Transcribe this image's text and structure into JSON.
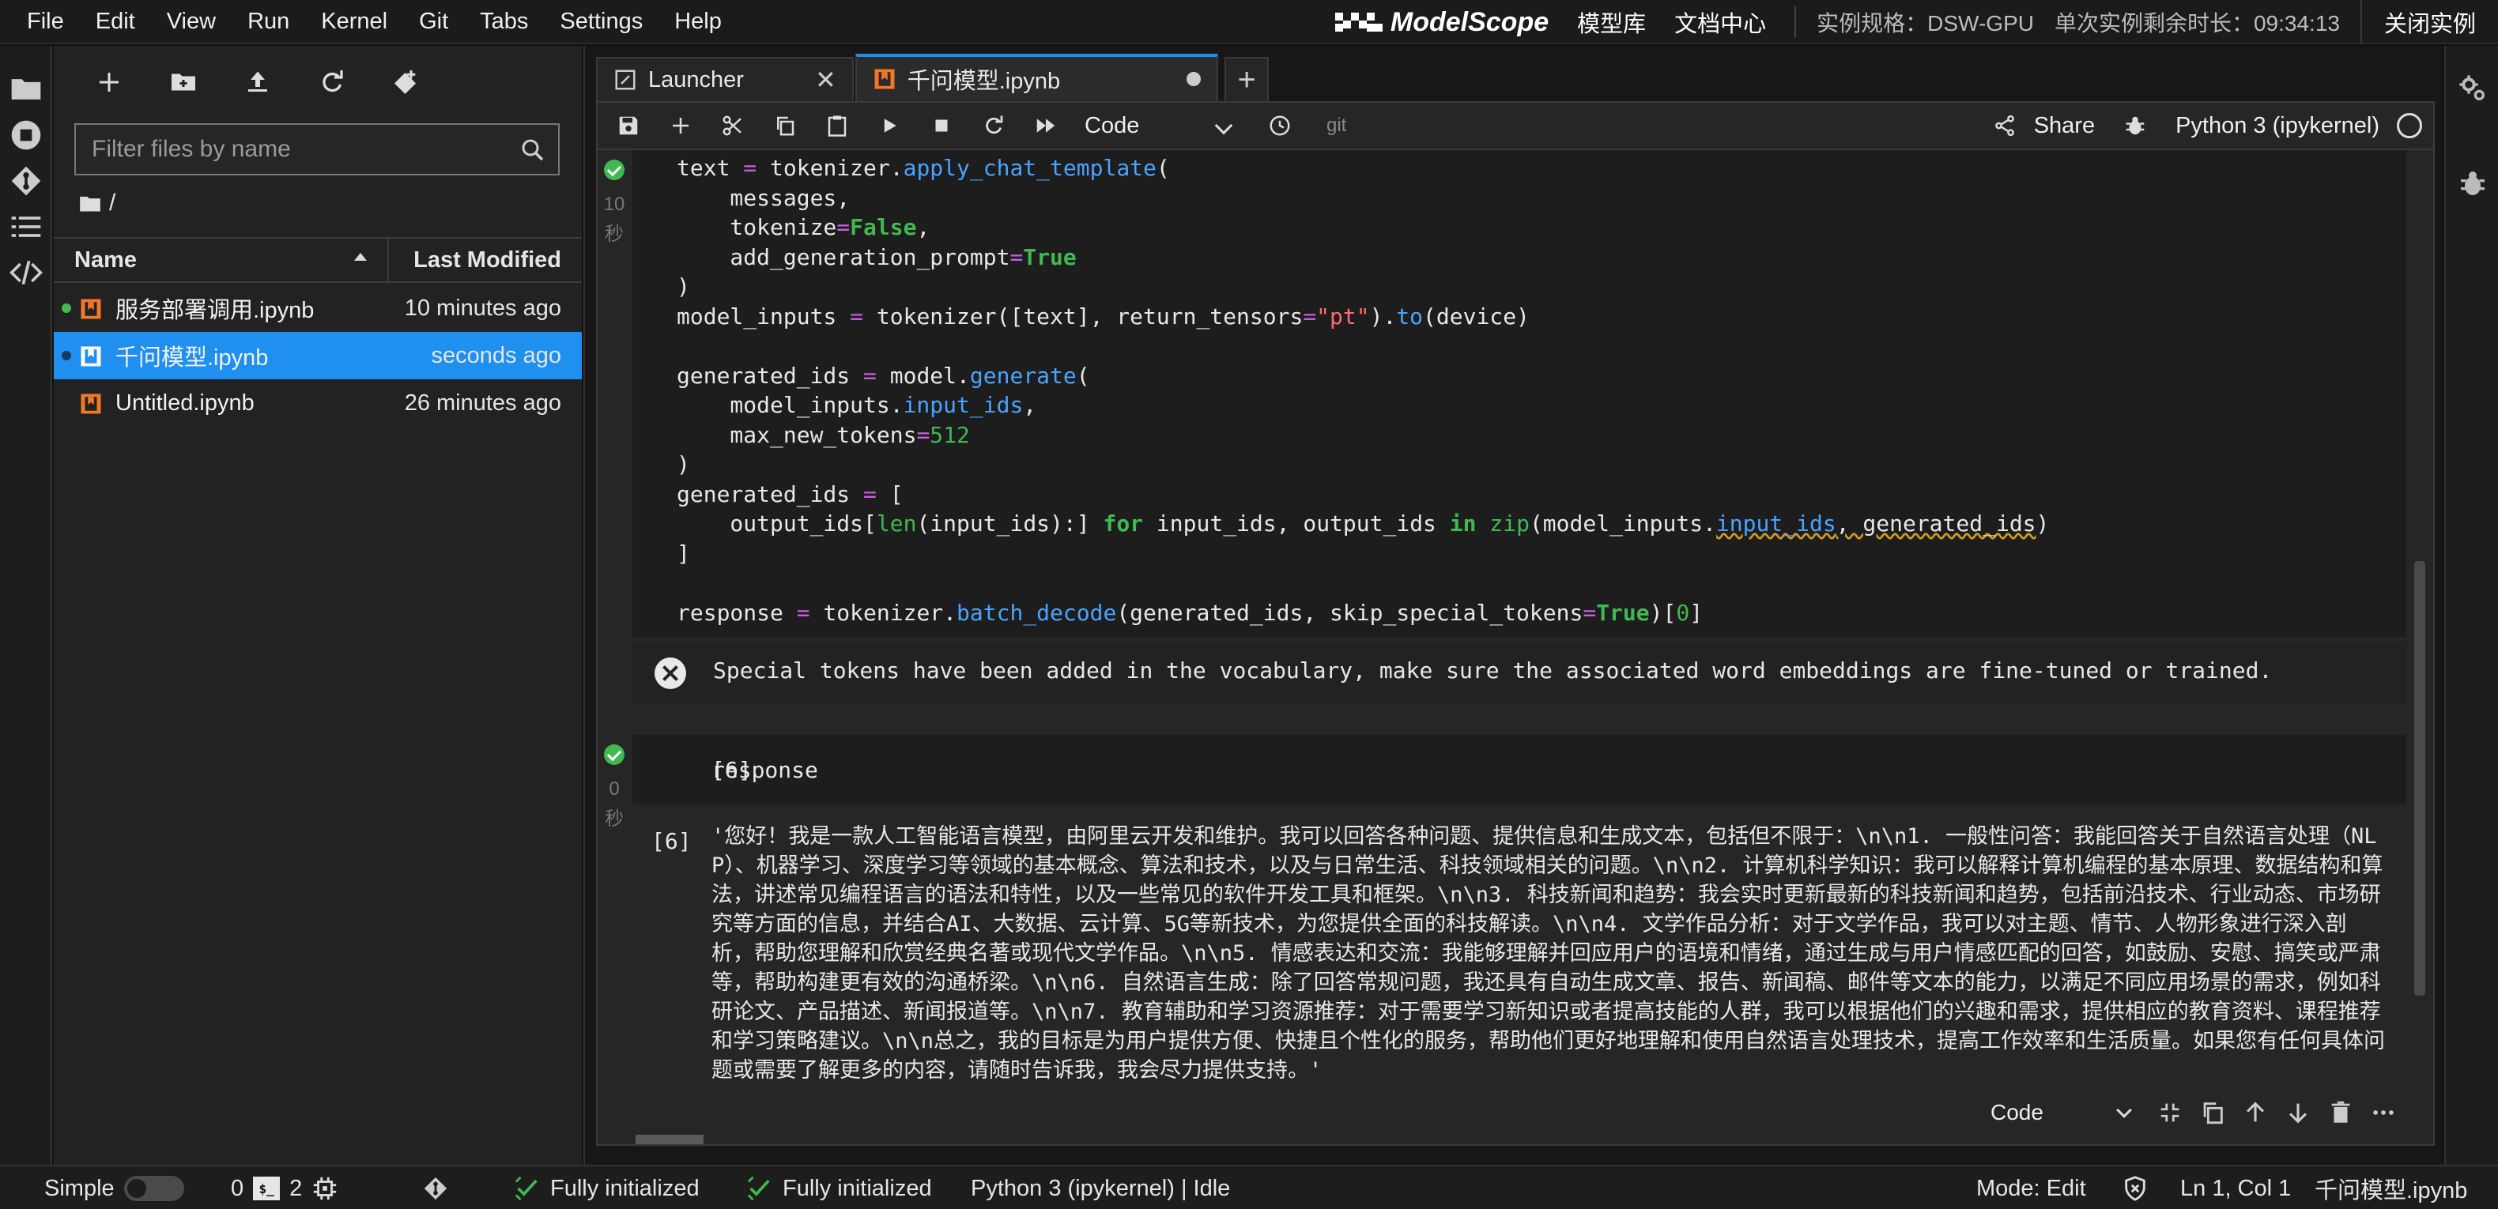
{
  "menubar": {
    "items": [
      "File",
      "Edit",
      "View",
      "Run",
      "Kernel",
      "Git",
      "Tabs",
      "Settings",
      "Help"
    ],
    "brand": "ModelScope",
    "links": [
      "模型库",
      "文档中心"
    ],
    "instance_spec": "实例规格：DSW-GPU",
    "remaining_time": "单次实例剩余时长：09:34:13",
    "close_label": "关闭实例"
  },
  "filebrowser": {
    "search_placeholder": "Filter files by name",
    "breadcrumb": "/",
    "col_name": "Name",
    "col_modified": "Last Modified",
    "files": [
      {
        "name": "服务部署调用.ipynb",
        "modified": "10 minutes ago",
        "status_dot": "#3fb950",
        "selected": false
      },
      {
        "name": "千问模型.ipynb",
        "modified": "seconds ago",
        "status_dot": "#1a3f66",
        "selected": true
      },
      {
        "name": "Untitled.ipynb",
        "modified": "26 minutes ago",
        "status_dot": "",
        "selected": false
      }
    ]
  },
  "tabs": [
    {
      "label": "Launcher",
      "icon": "launcher-icon",
      "active": false
    },
    {
      "label": "千问模型.ipynb",
      "icon": "notebook-icon",
      "active": true,
      "unsaved": true
    }
  ],
  "nbtoolbar": {
    "cell_type": "Code",
    "git_label": "git",
    "share_label": "Share",
    "kernel_name": "Python 3 (ipykernel)"
  },
  "cell1": {
    "exec_time": [
      "10",
      "秒"
    ]
  },
  "stderr": {
    "text": "Special tokens have been added in the vocabulary, make sure the associated word embeddings are fine-tuned or trained."
  },
  "cell2": {
    "prompt": "[6]",
    "code": "response",
    "exec_time": [
      "0",
      "秒"
    ],
    "out_prompt": "[6]",
    "output": "'您好！我是一款人工智能语言模型，由阿里云开发和维护。我可以回答各种问题、提供信息和生成文本，包括但不限于：\\n\\n1. 一般性问答：我能回答关于自然语言处理（NLP）、机器学习、深度学习等领域的基本概念、算法和技术，以及与日常生活、科技领域相关的问题。\\n\\n2. 计算机科学知识：我可以解释计算机编程的基本原理、数据结构和算法，讲述常见编程语言的语法和特性，以及一些常见的软件开发工具和框架。\\n\\n3. 科技新闻和趋势：我会实时更新最新的科技新闻和趋势，包括前沿技术、行业动态、市场研究等方面的信息，并结合AI、大数据、云计算、5G等新技术，为您提供全面的科技解读。\\n\\n4. 文学作品分析：对于文学作品，我可以对主题、情节、人物形象进行深入剖析，帮助您理解和欣赏经典名著或现代文学作品。\\n\\n5. 情感表达和交流：我能够理解并回应用户的语境和情绪，通过生成与用户情感匹配的回答，如鼓励、安慰、搞笑或严肃等，帮助构建更有效的沟通桥梁。\\n\\n6. 自然语言生成：除了回答常规问题，我还具有自动生成文章、报告、新闻稿、邮件等文本的能力，以满足不同应用场景的需求，例如科研论文、产品描述、新闻报道等。\\n\\n7. 教育辅助和学习资源推荐：对于需要学习新知识或者提高技能的人群，我可以根据他们的兴趣和需求，提供相应的教育资料、课程推荐和学习策略建议。\\n\\n总之，我的目标是为用户提供方便、快捷且个性化的服务，帮助他们更好地理解和使用自然语言处理技术，提高工作效率和生活质量。如果您有任何具体问题或需要了解更多的内容，请随时告诉我，我会尽力提供支持。'"
  },
  "celltoolbar": {
    "cell_type": "Code"
  },
  "statusbar": {
    "simple_label": "Simple",
    "terminals_count": "0",
    "kernels_count": "2",
    "init_1": "Fully initialized",
    "init_2": "Fully initialized",
    "kernel_status": "Python 3 (ipykernel) | Idle",
    "mode": "Mode: Edit",
    "cursor": "Ln 1, Col 1",
    "file": "千问模型.ipynb"
  },
  "colors": {
    "accent": "#1f8ff0",
    "keyword": "#3fb950",
    "function": "#4aa3ff",
    "operator": "#c760e0",
    "string": "#ff6b6b"
  }
}
